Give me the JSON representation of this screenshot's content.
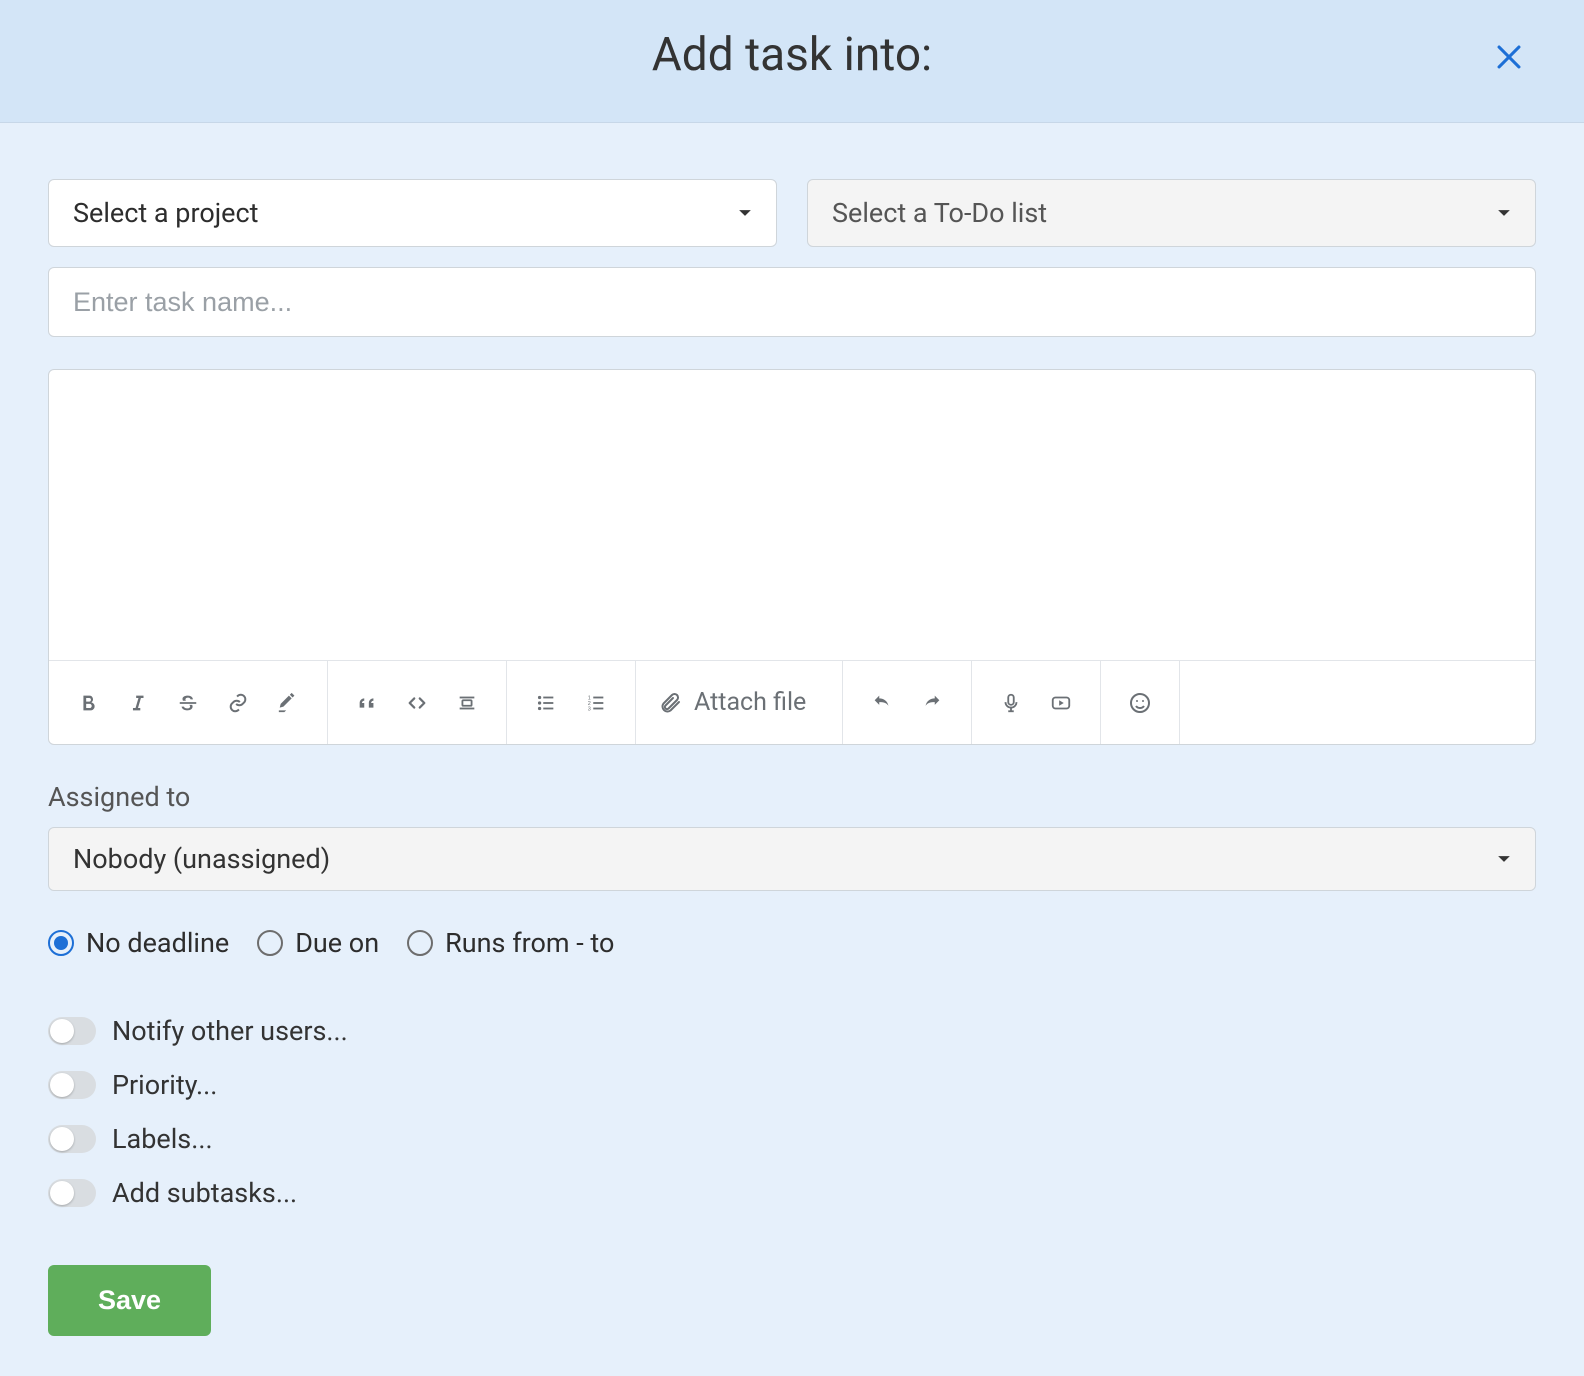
{
  "header": {
    "title": "Add task into:"
  },
  "selects": {
    "project_placeholder": "Select a project",
    "todo_placeholder": "Select a To-Do list"
  },
  "task_name_placeholder": "Enter task name...",
  "toolbar": {
    "attach_label": "Attach file"
  },
  "assigned": {
    "label": "Assigned to",
    "value": "Nobody (unassigned)"
  },
  "deadline": {
    "options": [
      {
        "label": "No deadline",
        "selected": true
      },
      {
        "label": "Due on",
        "selected": false
      },
      {
        "label": "Runs from - to",
        "selected": false
      }
    ]
  },
  "toggles": [
    {
      "label": "Notify other users...",
      "on": false
    },
    {
      "label": "Priority...",
      "on": false
    },
    {
      "label": "Labels...",
      "on": false
    },
    {
      "label": "Add subtasks...",
      "on": false
    }
  ],
  "save_label": "Save"
}
